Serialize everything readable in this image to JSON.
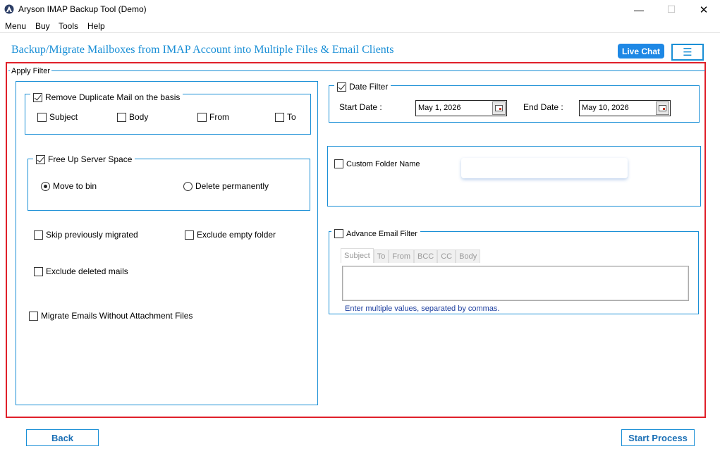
{
  "window": {
    "title": "Aryson IMAP Backup Tool (Demo)",
    "minimize_glyph": "—",
    "maximize_glyph": "☐",
    "close_glyph": "✕"
  },
  "menu": [
    "Menu",
    "Buy",
    "Tools",
    "Help"
  ],
  "header": {
    "title": "Backup/Migrate Mailboxes from IMAP Account into Multiple Files & Email Clients",
    "live_chat_label": "Live Chat",
    "menu_glyph": "☰"
  },
  "apply_filter": {
    "label": "Apply Filter",
    "remove_duplicate": {
      "label": "Remove Duplicate Mail on the basis",
      "checked": true,
      "options": [
        {
          "label": "Subject",
          "checked": false
        },
        {
          "label": "Body",
          "checked": false
        },
        {
          "label": "From",
          "checked": false
        },
        {
          "label": "To",
          "checked": false
        }
      ]
    },
    "free_up_space": {
      "label": "Free Up Server Space",
      "checked": true,
      "move_to_bin": "Move to bin",
      "delete_permanently": "Delete permanently",
      "selected": "Move to bin"
    },
    "skip_previously_migrated": "Skip previously migrated",
    "exclude_empty_folder": "Exclude empty folder",
    "exclude_deleted_mails": "Exclude deleted mails",
    "migrate_without_attachments": "Migrate Emails Without Attachment Files",
    "date_filter": {
      "label": "Date Filter",
      "checked": true,
      "start_label": "Start Date :",
      "start_value": "May 1, 2026",
      "end_label": "End Date :",
      "end_value": "May 10, 2026"
    },
    "custom_folder_name": {
      "label": "Custom Folder Name",
      "checked": false,
      "value": ""
    },
    "advance_email_filter": {
      "label": "Advance Email Filter",
      "checked": false,
      "tabs": [
        "Subject",
        "To",
        "From",
        "BCC",
        "CC",
        "Body"
      ],
      "active_tab": "Subject",
      "hint": "Enter multiple values, separated by commas."
    }
  },
  "footer": {
    "back_label": "Back",
    "start_label": "Start Process"
  },
  "colors": {
    "accent": "#1a8fd6",
    "live_chat_bg": "#1e88e5",
    "highlight_frame": "#e0202a"
  }
}
